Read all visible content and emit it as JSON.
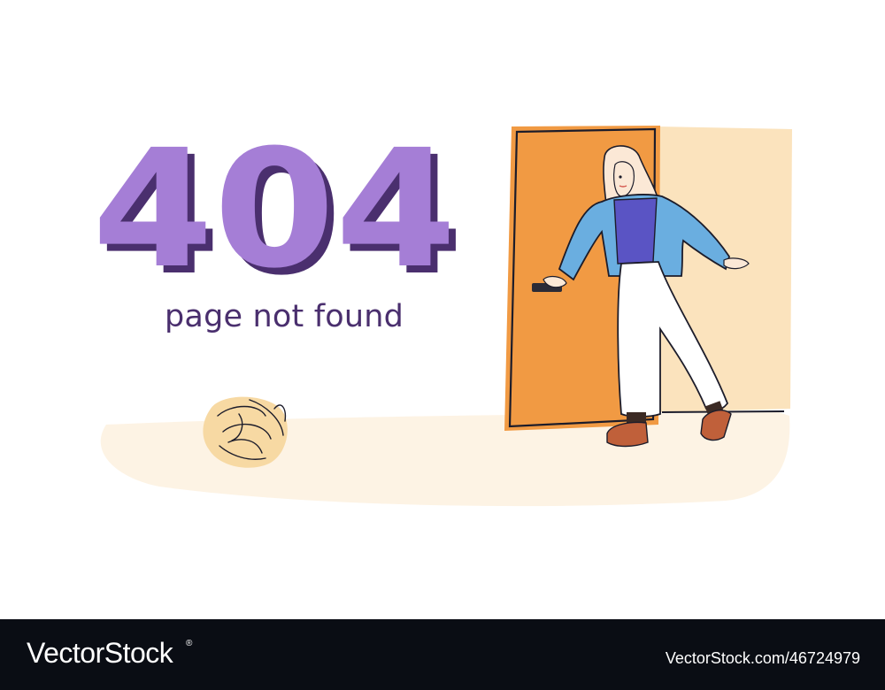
{
  "error": {
    "code": "404",
    "message": "page not found"
  },
  "footer": {
    "brand": "VectorStock",
    "brand_mark": "®",
    "asset_url": "VectorStock.com/46724979"
  },
  "illustration": {
    "icons": [
      "open-door-icon",
      "woman-figure-icon",
      "tumbleweed-icon"
    ]
  },
  "colors": {
    "code_fill": "#a57ed6",
    "code_shadow": "#4a2f6e",
    "message": "#4a2f6e",
    "door": "#f19a43",
    "doorway_light": "#fbe3bd",
    "floor": "#fdf3e4",
    "tumbleweed": "#f7d9a3",
    "jacket": "#6aaee0",
    "shirt": "#5a54c4",
    "footer_bg": "#0a0d14"
  }
}
